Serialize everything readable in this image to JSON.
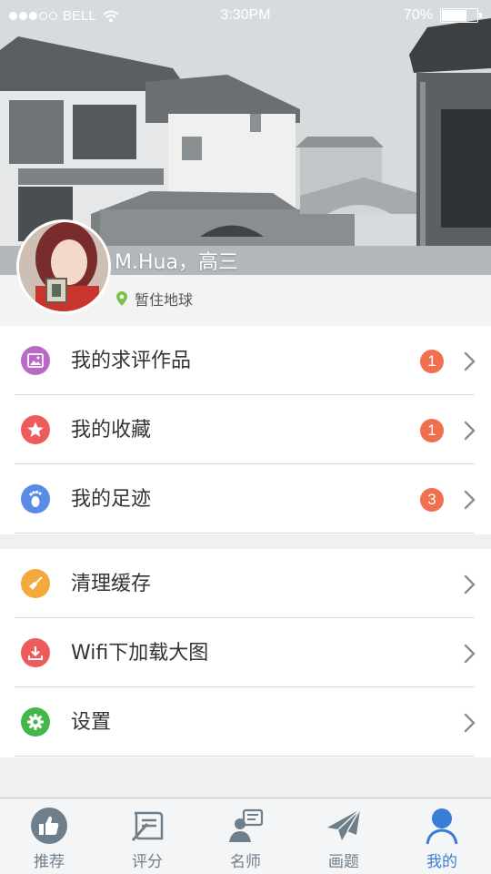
{
  "status_bar": {
    "carrier": "BELL",
    "time": "3:30PM",
    "battery_text": "70%",
    "battery_level": 0.7,
    "signal_bars_filled": 3,
    "signal_bars_total": 5
  },
  "profile": {
    "name": "M.Hua，高三",
    "location": "暂住地球",
    "location_icon": "map-pin-icon"
  },
  "menu_group1": [
    {
      "label": "我的求评作品",
      "badge": "1",
      "icon": "picture-icon",
      "color": "#b96ac7"
    },
    {
      "label": "我的收藏",
      "badge": "1",
      "icon": "star-icon",
      "color": "#ee5b5b"
    },
    {
      "label": "我的足迹",
      "badge": "3",
      "icon": "footprint-icon",
      "color": "#5a8be6"
    }
  ],
  "menu_group2": [
    {
      "label": "清理缓存",
      "icon": "broom-icon",
      "color": "#f4a93c"
    },
    {
      "label": "Wifi下加载大图",
      "icon": "download-icon",
      "color": "#ee5b5b"
    },
    {
      "label": "设置",
      "icon": "gear-icon",
      "color": "#45b649"
    }
  ],
  "tabs": [
    {
      "label": "推荐",
      "icon": "thumbs-up-icon",
      "active": false
    },
    {
      "label": "评分",
      "icon": "scroll-pen-icon",
      "active": false
    },
    {
      "label": "名师",
      "icon": "teacher-icon",
      "active": false
    },
    {
      "label": "画题",
      "icon": "paper-plane-icon",
      "active": false
    },
    {
      "label": "我的",
      "icon": "person-icon",
      "active": true
    }
  ],
  "colors": {
    "accent": "#3a7dd8",
    "badge": "#ef6f4f",
    "tab_inactive": "#6f7f8c"
  }
}
